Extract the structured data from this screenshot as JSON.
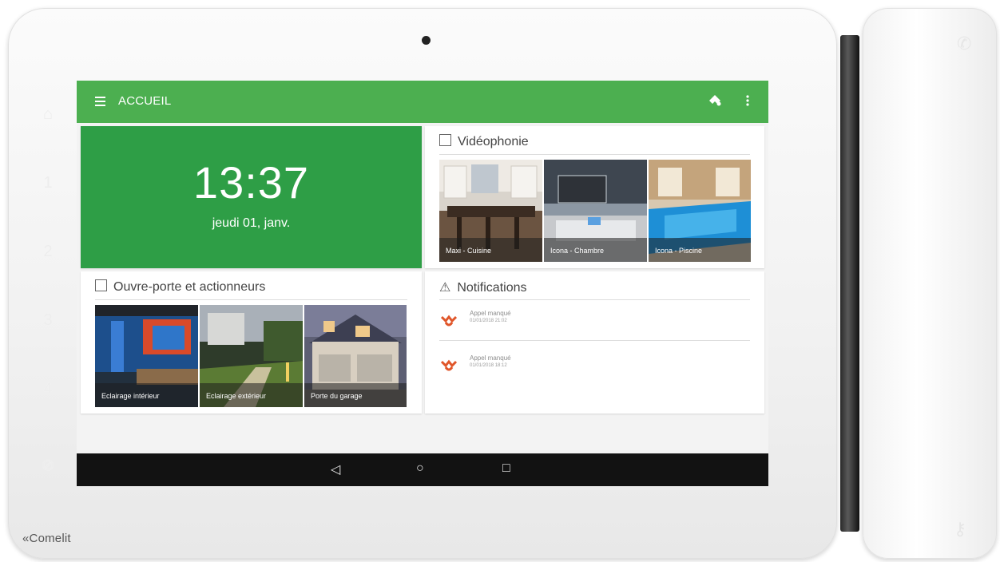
{
  "device": {
    "brand": "«Comelit",
    "side_keys": [
      "⌂",
      "1",
      "2",
      "3",
      "4",
      "⊘"
    ]
  },
  "appbar": {
    "title": "ACCUEIL",
    "color": "#4caf50"
  },
  "clock": {
    "time": "13:37",
    "date": "jeudi 01, janv.",
    "color": "#2e9e46"
  },
  "video_card": {
    "title": "Vidéophonie",
    "icon": "intercom-icon",
    "cameras": [
      {
        "label": "Maxi - Cuisine"
      },
      {
        "label": "Icona - Chambre"
      },
      {
        "label": "Icona - Piscine"
      }
    ]
  },
  "actuators_card": {
    "title": "Ouvre-porte et actionneurs",
    "icon": "door-icon",
    "items": [
      {
        "label": "Eclairage intérieur"
      },
      {
        "label": "Eclairage extérieur"
      },
      {
        "label": "Porte du garage"
      }
    ]
  },
  "notifications_card": {
    "title": "Notifications",
    "icon": "warning-icon",
    "items": [
      {
        "title": "Appel manqué",
        "time": "01/01/2018 21:02",
        "icon": "missed-call-icon"
      },
      {
        "title": "Appel manqué",
        "time": "01/01/2018 18:12",
        "icon": "missed-call-icon"
      }
    ]
  },
  "navbar": {
    "back": "◁",
    "home": "○",
    "recents": "□"
  }
}
